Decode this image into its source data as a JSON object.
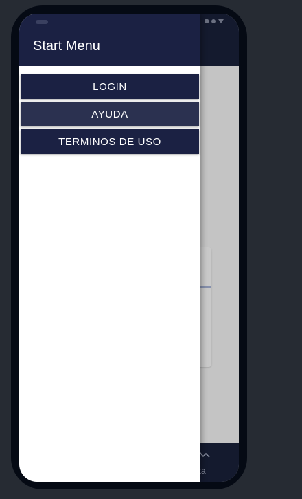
{
  "drawer": {
    "title": "Start Menu",
    "items": [
      {
        "label": "LOGIN"
      },
      {
        "label": "AYUDA"
      },
      {
        "label": "TERMINOS DE USO"
      }
    ]
  },
  "bottom_nav": {
    "label_fragment": "ata",
    "icon": "chart-line-icon"
  },
  "colors": {
    "page_background": "#262b33",
    "phone_frame": "#050a14",
    "drawer_header": "#1b2143",
    "menu_item": "#1b2143",
    "menu_item_active": "#2b3150",
    "drawer_body": "#ffffff",
    "scrim_content": "#c4c4c4"
  }
}
